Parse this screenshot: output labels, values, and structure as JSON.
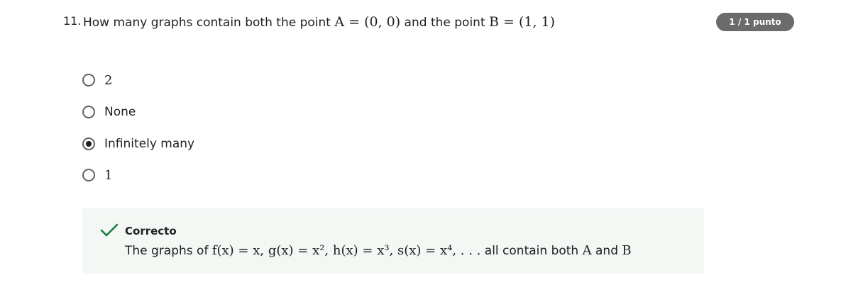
{
  "question": {
    "number": "11.",
    "prefix": "How many graphs contain both the point ",
    "point_a": "A = (0, 0)",
    "middle": " and the point ",
    "point_b": "B = (1, 1)"
  },
  "score": {
    "label": "1 / 1 punto"
  },
  "options": [
    {
      "label": "2",
      "selected": false
    },
    {
      "label": "None",
      "selected": false
    },
    {
      "label": "Infinitely many",
      "selected": true
    },
    {
      "label": "1",
      "selected": false
    }
  ],
  "feedback": {
    "status": "Correcto",
    "explanation_prefix": "The graphs of ",
    "explanation_math": "f(x) = x, g(x) = x², h(x) = x³, s(x) = x⁴, . . .",
    "explanation_middle": " all contain both ",
    "explanation_a": "A",
    "explanation_and": " and ",
    "explanation_b": "B",
    "accent_color": "#1a7a3c"
  },
  "icons": {
    "check": "check-icon",
    "radio": "radio-button"
  }
}
